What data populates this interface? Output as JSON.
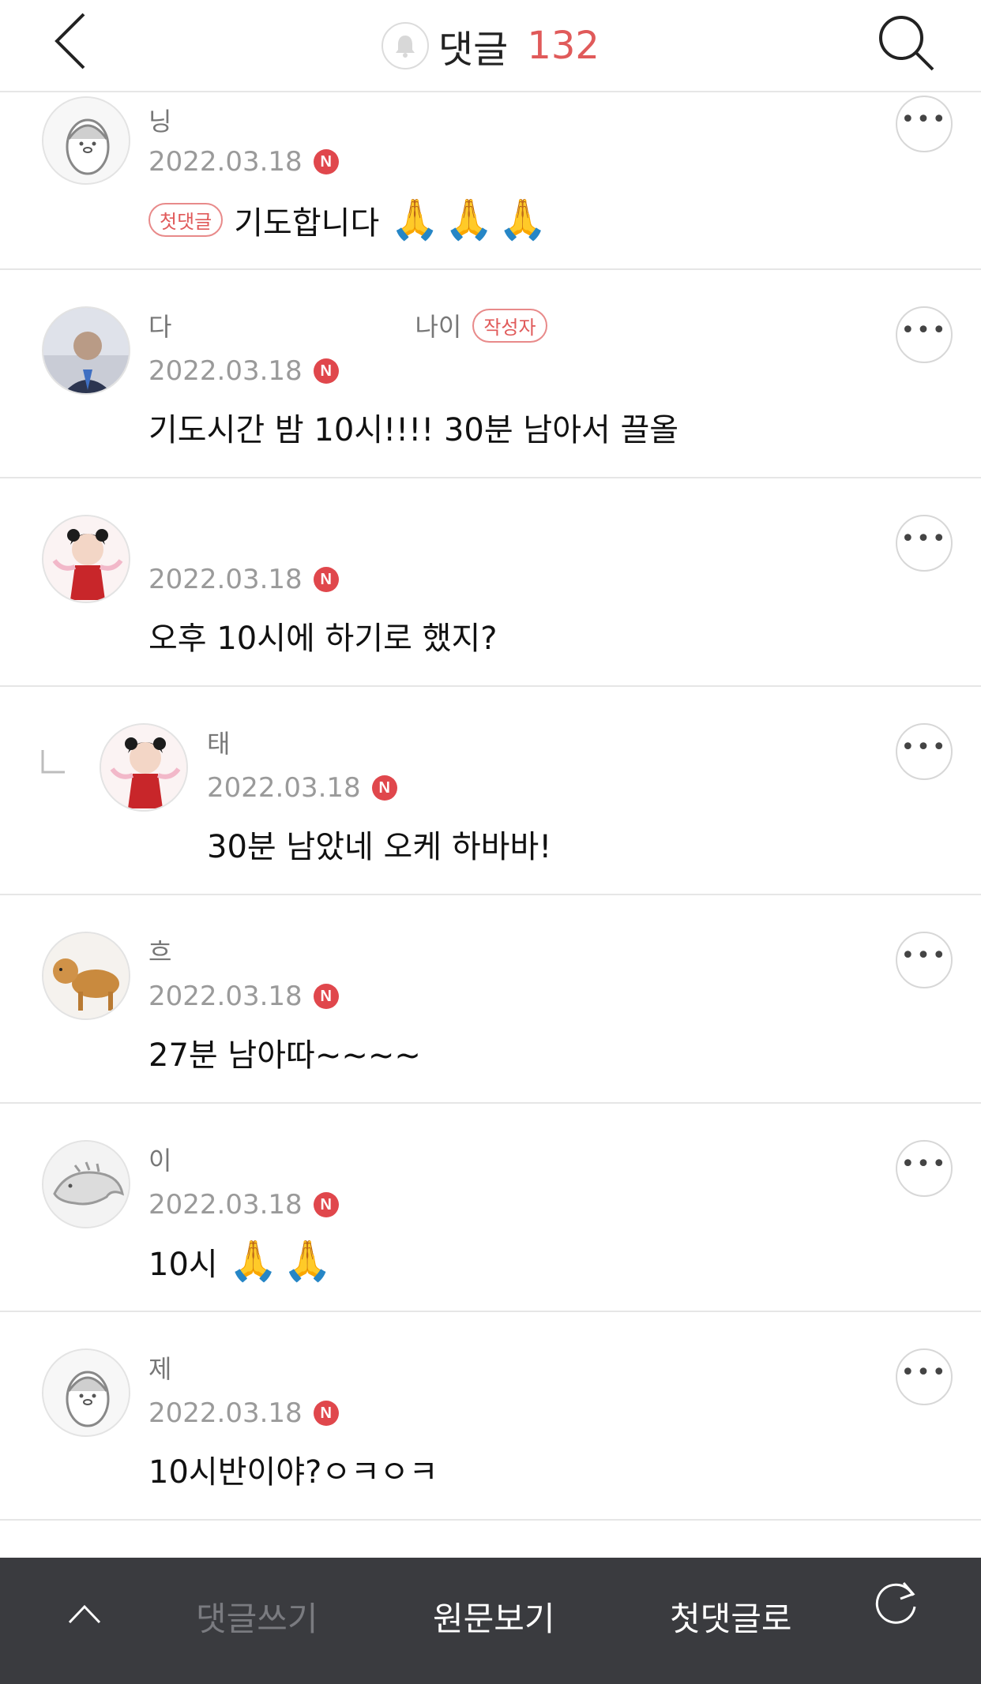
{
  "header": {
    "title": "댓글",
    "count": "132",
    "back_icon": "chevron-left-icon",
    "search_icon": "search-icon",
    "bell_icon": "bell-icon"
  },
  "comments": [
    {
      "name": "닝",
      "date": "2022.03.18",
      "badge": "N",
      "first_tag": "첫댓글",
      "text": "기도합니다",
      "emoji": "🙏🙏🙏"
    },
    {
      "name_start": "다",
      "name_end": "나이",
      "author_tag": "작성자",
      "date": "2022.03.18",
      "badge": "N",
      "text": "기도시간 밤 10시!!!! 30분 남아서 끌올"
    },
    {
      "date": "2022.03.18",
      "badge": "N",
      "text": "오후 10시에 하기로 했지?"
    },
    {
      "name": "태",
      "date": "2022.03.18",
      "badge": "N",
      "text": "30분 남았네 오케 하바바!"
    },
    {
      "name": "흐",
      "date": "2022.03.18",
      "badge": "N",
      "text": "27분 남아따~~~~"
    },
    {
      "name": "이",
      "date": "2022.03.18",
      "badge": "N",
      "text": "10시",
      "emoji": "🙏🙏"
    },
    {
      "name": "제",
      "date": "2022.03.18",
      "badge": "N",
      "text": "10시반이야?ㅇㅋㅇㅋ"
    }
  ],
  "bottom_bar": {
    "write": "댓글쓰기",
    "original": "원문보기",
    "first_comment": "첫댓글로",
    "up_icon": "chevron-up-icon",
    "refresh_icon": "refresh-icon"
  },
  "colors": {
    "accent": "#e05a5a",
    "badge": "#e0474c",
    "bottom_bar": "#3a3b3f"
  }
}
